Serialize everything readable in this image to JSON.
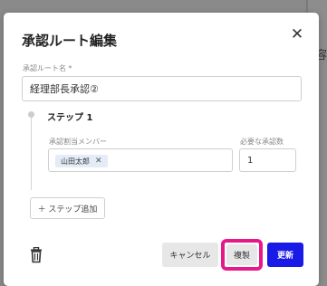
{
  "background": {
    "side_text": "容"
  },
  "dialog": {
    "title": "承認ルート編集",
    "route_name_label": "承認ルート名 *",
    "route_name_value": "経理部長承認②",
    "step": {
      "title": "ステップ 1",
      "members_label": "承認割当メンバー",
      "member_chip": "山田太郎",
      "required_label": "必要な承認数",
      "required_value": "1"
    },
    "add_step_label": "＋ ステップ追加",
    "buttons": {
      "cancel": "キャンセル",
      "copy": "複製",
      "update": "更新"
    }
  },
  "colors": {
    "primary": "#1a1ae6",
    "highlight": "#e6198a",
    "chip_bg": "#e3ecf7"
  }
}
